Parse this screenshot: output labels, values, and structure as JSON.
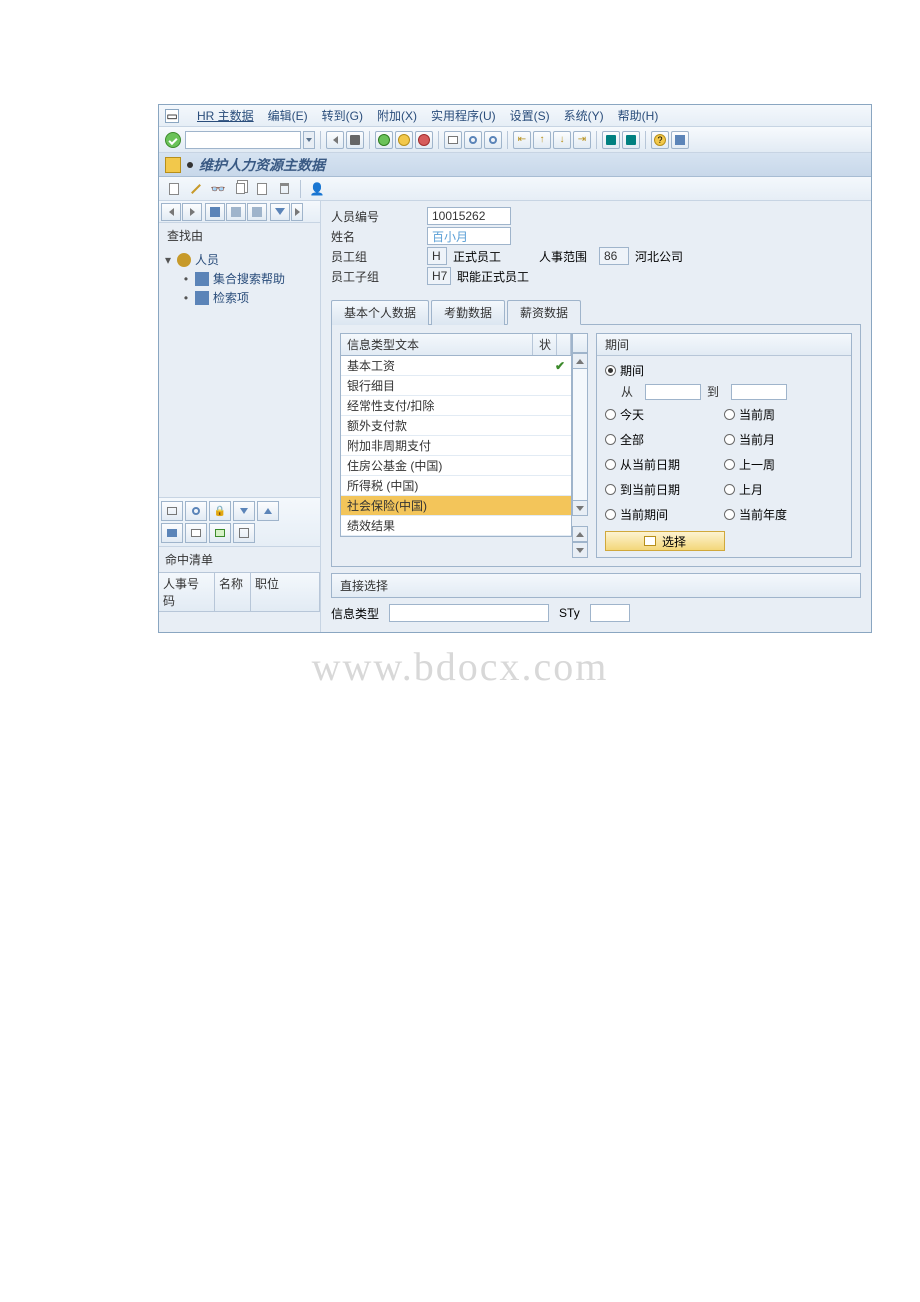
{
  "menu": {
    "main": "HR 主数据",
    "edit": "编辑(E)",
    "goto": "转到(G)",
    "extras": "附加(X)",
    "utilities": "实用程序(U)",
    "settings": "设置(S)",
    "system": "系统(Y)",
    "help": "帮助(H)"
  },
  "title": "维护人力资源主数据",
  "left": {
    "find": "查找由",
    "tree": {
      "person": "人员",
      "collective": "集合搜索帮助",
      "searchterm": "检索项"
    },
    "hit": "命中清单",
    "cols": {
      "pernr": "人事号码",
      "name": "名称",
      "pos": "职位"
    }
  },
  "hdr": {
    "pernr_l": "人员编号",
    "pernr_v": "10015262",
    "name_l": "姓名",
    "name_v": "百小月",
    "eg_l": "员工组",
    "eg_code": "H",
    "eg_txt": "正式员工",
    "pa_l": "人事范围",
    "pa_code": "86",
    "pa_txt": "河北公司",
    "esg_l": "员工子组",
    "esg_code": "H7",
    "esg_txt": "职能正式员工"
  },
  "tabs": {
    "t1": "基本个人数据",
    "t2": "考勤数据",
    "t3": "薪资数据"
  },
  "list": {
    "hdr_text": "信息类型文本",
    "hdr_status": "状",
    "items": [
      "基本工资",
      "银行细目",
      "经常性支付/扣除",
      "额外支付款",
      "附加非周期支付",
      "住房公基金 (中国)",
      "所得税 (中国)",
      "社会保险(中国)",
      "绩效结果"
    ]
  },
  "period": {
    "hdr": "期间",
    "opt_period": "期间",
    "from": "从",
    "to": "到",
    "today": "今天",
    "cur_week": "当前周",
    "all": "全部",
    "cur_month": "当前月",
    "from_cur": "从当前日期",
    "last_week": "上一周",
    "to_cur": "到当前日期",
    "last_month": "上月",
    "cur_period": "当前期间",
    "cur_year": "当前年度",
    "select": "选择"
  },
  "direct": {
    "hdr": "直接选择",
    "infotype": "信息类型",
    "sty": "STy"
  },
  "watermark": "www.bdocx.com"
}
